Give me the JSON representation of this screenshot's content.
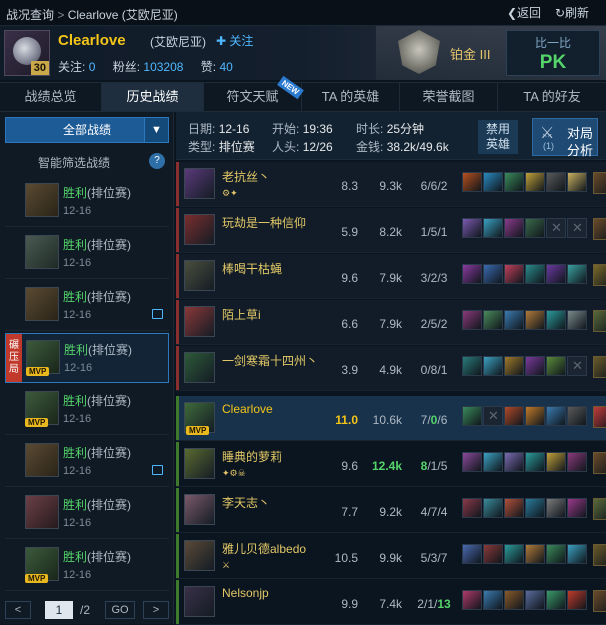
{
  "topbar": {
    "breadcrumb_root": "战况查询",
    "breadcrumb_sep": ">",
    "breadcrumb_current": "Clearlove (艾欧尼亚)",
    "back_label": "❮返回",
    "refresh_label": "↻刷新"
  },
  "profile": {
    "level": "30",
    "name": "Clearlove",
    "server": "(艾欧尼亚)",
    "follow_label": "✚ 关注",
    "following_label": "关注:",
    "following": "0",
    "fans_label": "粉丝:",
    "fans": "103208",
    "likes_label": "赞:",
    "likes": "40",
    "rank": "铂金 III",
    "pk_title": "比一比",
    "pk_label": "PK"
  },
  "tabs": [
    "战绩总览",
    "历史战绩",
    "符文天赋",
    "TA 的英雄",
    "荣誉截图",
    "TA 的好友"
  ],
  "new_badge": "NEW",
  "left": {
    "all_label": "全部战绩",
    "dropdown": "▼",
    "filter_label": "智能筛选战绩",
    "help": "?",
    "games": [
      {
        "result": "胜利",
        "queue": "(排位赛)",
        "date": "12-16",
        "mvp": false,
        "image": false
      },
      {
        "result": "胜利",
        "queue": "(排位赛)",
        "date": "12-16",
        "mvp": false,
        "image": false
      },
      {
        "result": "胜利",
        "queue": "(排位赛)",
        "date": "12-16",
        "mvp": false,
        "image": true
      },
      {
        "result": "胜利",
        "queue": "(排位赛)",
        "date": "12-16",
        "mvp": true,
        "image": false,
        "crush": "碾压局"
      },
      {
        "result": "胜利",
        "queue": "(排位赛)",
        "date": "12-16",
        "mvp": true,
        "image": false
      },
      {
        "result": "胜利",
        "queue": "(排位赛)",
        "date": "12-16",
        "mvp": false,
        "image": true
      },
      {
        "result": "胜利",
        "queue": "(排位赛)",
        "date": "12-16",
        "mvp": false,
        "image": false
      },
      {
        "result": "胜利",
        "queue": "(排位赛)",
        "date": "12-16",
        "mvp": true,
        "image": false
      }
    ],
    "mvp_label": "MVP",
    "pager": {
      "prev": "<",
      "page": "1",
      "total": "/2",
      "go": "GO",
      "next": ">"
    }
  },
  "match": {
    "date_label": "日期:",
    "date": "12-16",
    "start_label": "开始:",
    "start": "19:36",
    "duration_label": "时长:",
    "duration": "25分钟",
    "type_label": "类型:",
    "type": "排位赛",
    "kills_label": "人头:",
    "kills": "12/26",
    "gold_label": "金钱:",
    "gold": "38.2k/49.6k",
    "ban_label": "禁用\n英雄",
    "analysis_l1": "对局",
    "analysis_l2": "分析",
    "analysis_key": "(1)"
  },
  "players": [
    {
      "name": "老抗丝丶",
      "score": "8.3",
      "gold": "9.3k",
      "k": "6",
      "d": "6",
      "a": "2",
      "team": "red",
      "badges": "⚙✦",
      "champ": "#5a3a7a"
    },
    {
      "name": "玩劫是一种信仰",
      "score": "5.9",
      "gold": "8.2k",
      "k": "1",
      "d": "5",
      "a": "1",
      "team": "red",
      "badges": "",
      "champ": "#7a2e2e"
    },
    {
      "name": "棒喝干枯蝇",
      "score": "9.6",
      "gold": "7.9k",
      "k": "3",
      "d": "2",
      "a": "3",
      "team": "red",
      "badges": "",
      "champ": "#4a4e3e"
    },
    {
      "name": "陌上草i",
      "score": "6.6",
      "gold": "7.9k",
      "k": "2",
      "d": "5",
      "a": "2",
      "team": "red",
      "badges": "",
      "champ": "#8a3838"
    },
    {
      "name": "一剑寒霜十四州丶",
      "score": "3.9",
      "gold": "4.9k",
      "k": "0",
      "d": "8",
      "a": "1",
      "team": "red",
      "badges": "",
      "champ": "#2e5a3a"
    },
    {
      "name": "Clearlove",
      "score": "11.0",
      "gold": "10.6k",
      "k": "7",
      "d": "0",
      "a": "6",
      "team": "me",
      "badges": "MVP",
      "champ": "#3e6a3a"
    },
    {
      "name": "睡典的萝莉",
      "score": "9.6",
      "gold": "12.4k",
      "k": "8",
      "d": "1",
      "a": "5",
      "team": "blue",
      "badges": "✦⚙☠",
      "champ": "#5a6a30"
    },
    {
      "name": "李天志丶",
      "score": "7.7",
      "gold": "9.2k",
      "k": "4",
      "d": "7",
      "a": "4",
      "team": "blue",
      "badges": "",
      "champ": "#7a5a6a"
    },
    {
      "name": "雅儿贝德albedo",
      "score": "10.5",
      "gold": "9.9k",
      "k": "5",
      "d": "3",
      "a": "7",
      "team": "blue",
      "badges": "⚔",
      "champ": "#5a4a38"
    },
    {
      "name": "Nelsonjp",
      "score": "9.9",
      "gold": "7.4k",
      "k": "2",
      "d": "1",
      "a": "13",
      "team": "blue",
      "badges": "",
      "champ": "#3a3048"
    }
  ],
  "colors": {
    "accent": "#2d78bd",
    "win": "#55d46a",
    "gold": "#f5c518",
    "link": "#4fb7ff"
  }
}
